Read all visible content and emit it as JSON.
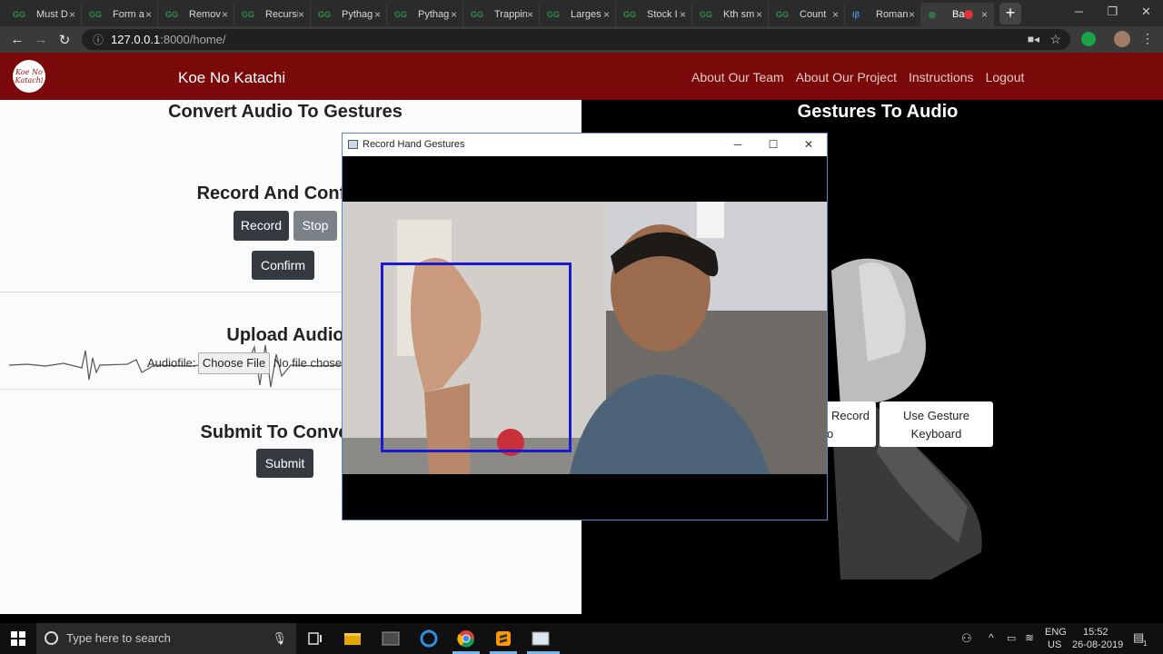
{
  "browser": {
    "tabs": [
      {
        "icon": "GG",
        "title": "Must D"
      },
      {
        "icon": "GG",
        "title": "Form a"
      },
      {
        "icon": "GG",
        "title": "Remov"
      },
      {
        "icon": "GG",
        "title": "Recursi"
      },
      {
        "icon": "GG",
        "title": "Pythag"
      },
      {
        "icon": "GG",
        "title": "Pythag"
      },
      {
        "icon": "GG",
        "title": "Trappin"
      },
      {
        "icon": "GG",
        "title": "Larges"
      },
      {
        "icon": "GG",
        "title": "Stock I"
      },
      {
        "icon": "GG",
        "title": "Kth sm"
      },
      {
        "icon": "GG",
        "title": "Count"
      },
      {
        "icon": "iβ",
        "title": "Roman"
      },
      {
        "icon": "globe",
        "title": "Ba"
      }
    ],
    "address": {
      "host": "127.0.0.1",
      "path": ":8000/home/"
    }
  },
  "site": {
    "logo_text": "Koe No Katachi",
    "brand": "Koe No Katachi",
    "nav": [
      "About Our Team",
      "About Our Project",
      "Instructions",
      "Logout"
    ]
  },
  "left_panel": {
    "heading": "Convert Audio To Gestures",
    "record_heading": "Record And Confirm",
    "record_btn": "Record",
    "stop_btn": "Stop",
    "confirm_btn": "Confirm",
    "upload_heading": "Upload Audio",
    "file_label": "Audiofile:",
    "choose_file": "Choose File",
    "no_file": "No file chose",
    "submit_heading": "Submit To Conve",
    "submit_btn": "Submit"
  },
  "right_panel": {
    "heading": "Gestures To Audio",
    "record_btn_line1": "Record",
    "record_btn_line2": "o",
    "keyboard_btn_line1": "Use Gesture",
    "keyboard_btn_line2": "Keyboard"
  },
  "cv_window": {
    "title": "Record Hand Gestures",
    "roi_color": "#1919d6"
  },
  "taskbar": {
    "search_placeholder": "Type here to search",
    "lang": "ENG",
    "region": "US",
    "time": "15:52",
    "date": "26-08-2019",
    "notif_count": "1"
  },
  "colors": {
    "navbar": "#7a0a0a",
    "dark_btn": "#343a40",
    "gray_btn": "#7b8287"
  }
}
